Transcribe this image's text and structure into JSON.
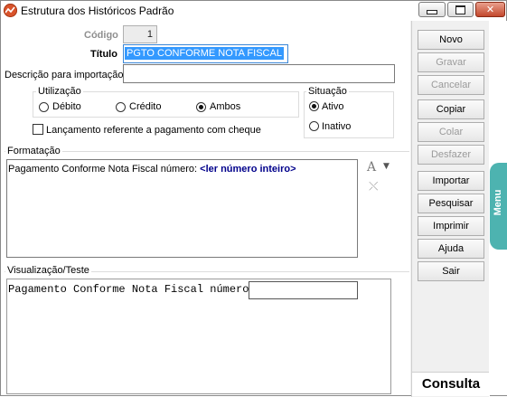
{
  "window": {
    "title": "Estrutura dos Históricos Padrão"
  },
  "form": {
    "codigo_label": "Código",
    "codigo_value": "1",
    "titulo_label": "Título",
    "titulo_value": "PGTO CONFORME NOTA FISCAL",
    "descricao_label": "Descrição para importação",
    "descricao_value": "",
    "utilizacao": {
      "title": "Utilização",
      "options": [
        "Débito",
        "Crédito",
        "Ambos"
      ],
      "selected": "Ambos"
    },
    "situacao": {
      "title": "Situação",
      "options": [
        "Ativo",
        "Inativo"
      ],
      "selected": "Ativo"
    },
    "cheque_label": "Lançamento referente a pagamento com cheque"
  },
  "formatacao": {
    "title": "Formatação",
    "text": "Pagamento Conforme Nota Fiscal número: ",
    "token": "<ler número inteiro>"
  },
  "visualizacao": {
    "title": "Visualização/Teste",
    "text": "Pagamento Conforme Nota Fiscal número:",
    "input_value": ""
  },
  "sidebar": {
    "buttons": [
      {
        "label": "Novo",
        "enabled": true
      },
      {
        "label": "Gravar",
        "enabled": false
      },
      {
        "label": "Cancelar",
        "enabled": false
      },
      {
        "label": "Copiar",
        "enabled": true
      },
      {
        "label": "Colar",
        "enabled": false
      },
      {
        "label": "Desfazer",
        "enabled": false
      },
      {
        "label": "Importar",
        "enabled": true
      },
      {
        "label": "Pesquisar",
        "enabled": true
      },
      {
        "label": "Imprimir",
        "enabled": true
      },
      {
        "label": "Ajuda",
        "enabled": true
      },
      {
        "label": "Sair",
        "enabled": true
      }
    ],
    "mode_label": "Consulta"
  },
  "menu_tab": {
    "label": "Menu",
    "color": "#4db3b0"
  },
  "icons": [
    "app-icon",
    "font-icon",
    "dropdown-arrow-icon",
    "clear-format-icon"
  ]
}
